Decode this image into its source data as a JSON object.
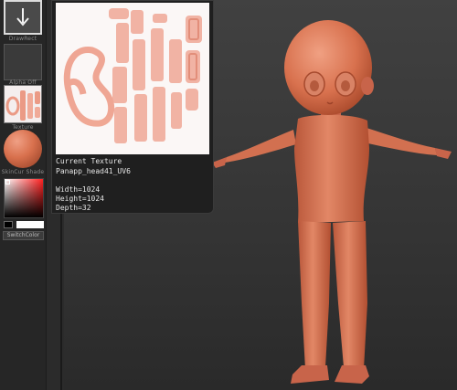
{
  "shelf": {
    "draw_rect_label": "DrawRect",
    "alpha_label": "Alpha Off",
    "texture_label": "Texture",
    "material_label": "SkinCur Shade",
    "switch_color_label": "SwitchColor"
  },
  "tooltip": {
    "title": "Current Texture",
    "texture_name": "Panapp_head41_UV6",
    "width_text": "Width=1024",
    "height_text": "Height=1024",
    "depth_text": "Depth=32"
  },
  "colors": {
    "model_skin": "#d8714e",
    "viewport_bg": "#3a3a3a",
    "uv_islands": "#ec9a86"
  }
}
